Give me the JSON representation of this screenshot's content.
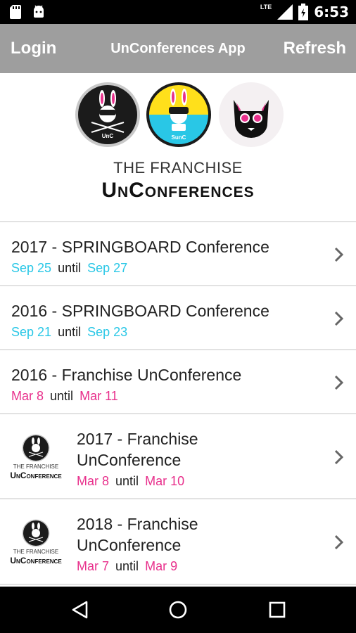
{
  "status_bar": {
    "time": "6:53",
    "network": "LTE",
    "icons": [
      "sd-card-icon",
      "android-icon",
      "signal-icon",
      "battery-icon"
    ]
  },
  "app_bar": {
    "login_label": "Login",
    "title": "UnConferences App",
    "refresh_label": "Refresh",
    "background": "#9e9e9e"
  },
  "header": {
    "brand_sub": "THE FRANCHISE",
    "brand_main": "UnConferences",
    "logos": [
      {
        "name": "unc-logo",
        "text": "UnC"
      },
      {
        "name": "sunc-logo",
        "text": "SunC"
      },
      {
        "name": "cat-logo",
        "text": ""
      }
    ]
  },
  "colors": {
    "springboard_date": "#29c7e6",
    "franchise_date": "#e8308c"
  },
  "conferences": [
    {
      "title": "2017 - SPRINGBOARD Conference",
      "start": "Sep 25",
      "until": "until",
      "end": "Sep 27",
      "color": "cyan",
      "thumbnail": false
    },
    {
      "title": "2016 - SPRINGBOARD Conference",
      "start": "Sep 21",
      "until": "until",
      "end": "Sep 23",
      "color": "cyan",
      "thumbnail": false
    },
    {
      "title": "2016 - Franchise UnConference",
      "start": "Mar 8",
      "until": "until",
      "end": "Mar 11",
      "color": "pink",
      "thumbnail": false
    },
    {
      "title_line1": "2017 - Franchise",
      "title_line2": "UnConference",
      "start": "Mar 8",
      "until": "until",
      "end": "Mar 10",
      "color": "pink",
      "thumbnail": true,
      "thumb_sub": "THE FRANCHISE",
      "thumb_main": "UnConference"
    },
    {
      "title_line1": "2018 - Franchise",
      "title_line2": "UnConference",
      "start": "Mar 7",
      "until": "until",
      "end": "Mar 9",
      "color": "pink",
      "thumbnail": true,
      "thumb_sub": "THE FRANCHISE",
      "thumb_main": "UnConference"
    }
  ],
  "nav_bar": {
    "buttons": [
      "back-icon",
      "home-icon",
      "recents-icon"
    ]
  }
}
